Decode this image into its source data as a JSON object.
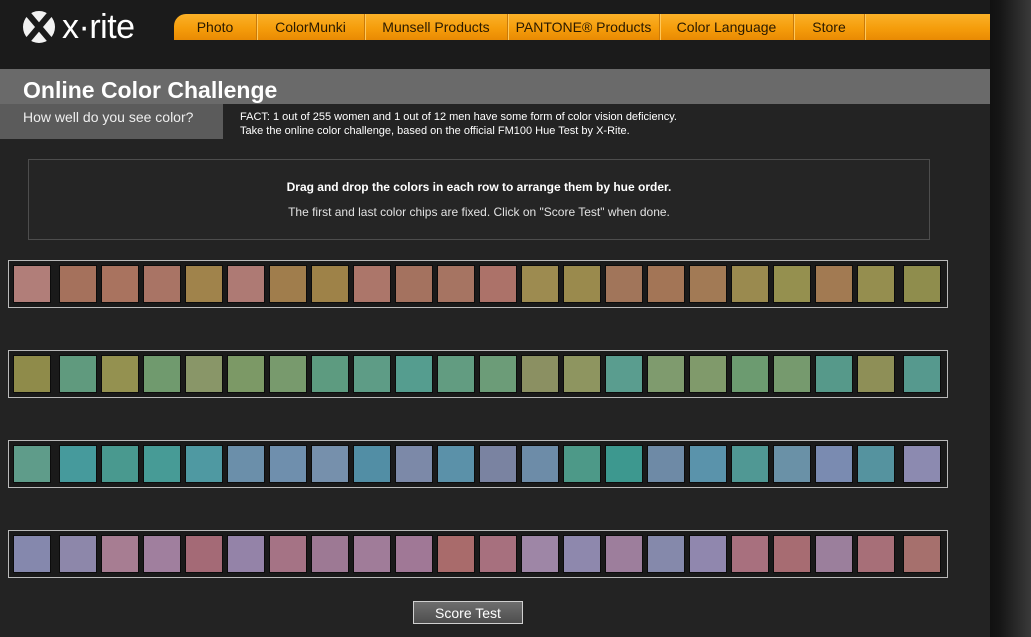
{
  "brand": {
    "logo_text": "x·rite",
    "logo_icon": "xrite-x-mark-icon"
  },
  "nav": {
    "items": [
      {
        "label": "Photo"
      },
      {
        "label": "ColorMunki"
      },
      {
        "label": "Munsell Products"
      },
      {
        "label": "PANTONE® Products"
      },
      {
        "label": "Color Language"
      },
      {
        "label": "Store"
      }
    ]
  },
  "page": {
    "title": "Online Color Challenge",
    "subtitle": "How well do you see color?",
    "fact_line1": "FACT: 1 out of 255 women and 1 out of 12 men have some form of color vision deficiency.",
    "fact_line2": "Take the online color challenge, based on the official FM100 Hue Test by X-Rite."
  },
  "instructions": {
    "heading": "Drag and drop the colors in each row to arrange them by hue order.",
    "body": "The first and last color chips are fixed. Click on \"Score Test\" when done."
  },
  "colors": {
    "nav_accent": "#f7a21b",
    "background": "#232323",
    "title_band": "#6a6a6a"
  },
  "rows": [
    [
      "#b17e79",
      "#a5715c",
      "#a9735f",
      "#a97465",
      "#a0834b",
      "#ae7a74",
      "#a07d4c",
      "#9e8248",
      "#ac766a",
      "#a4725f",
      "#a67462",
      "#ac7269",
      "#9d8b50",
      "#9a8a4d",
      "#a1755a",
      "#a37556",
      "#a27a55",
      "#9a8a4f",
      "#95904f",
      "#a27a52",
      "#958e4f",
      "#8f8d4d"
    ],
    [
      "#8f8b4a",
      "#609a7e",
      "#949150",
      "#709a6e",
      "#899668",
      "#7c9966",
      "#789a6d",
      "#5d9b80",
      "#5e9c86",
      "#559d8f",
      "#629c81",
      "#6c9c78",
      "#8b9062",
      "#8e9560",
      "#5a9d8f",
      "#7f9b6e",
      "#809a6b",
      "#6c9b70",
      "#769a6e",
      "#56998a",
      "#8e8f57",
      "#56998e"
    ],
    [
      "#5f9c8a",
      "#469a9c",
      "#49998f",
      "#479b96",
      "#4f99a2",
      "#6b8faa",
      "#6f8fad",
      "#7690ac",
      "#528ea5",
      "#7c89a8",
      "#5b91a9",
      "#7a83a1",
      "#6d8ca8",
      "#4d9988",
      "#3d988f",
      "#6e8aa6",
      "#5a93ab",
      "#509894",
      "#6a91a7",
      "#7a8bb1",
      "#55939f",
      "#8c8ab0"
    ],
    [
      "#8588ad",
      "#8d87aa",
      "#a77d92",
      "#a07f9e",
      "#a46a76",
      "#9483a8",
      "#a57385",
      "#9d7994",
      "#a07c99",
      "#a07896",
      "#a96b6b",
      "#a7707e",
      "#9e86a6",
      "#8e88ad",
      "#9d7e9c",
      "#8589ab",
      "#9087ae",
      "#a8707e",
      "#a76c72",
      "#9b7f9c",
      "#a76f78",
      "#a6706d"
    ]
  ],
  "actions": {
    "score_label": "Score Test"
  }
}
